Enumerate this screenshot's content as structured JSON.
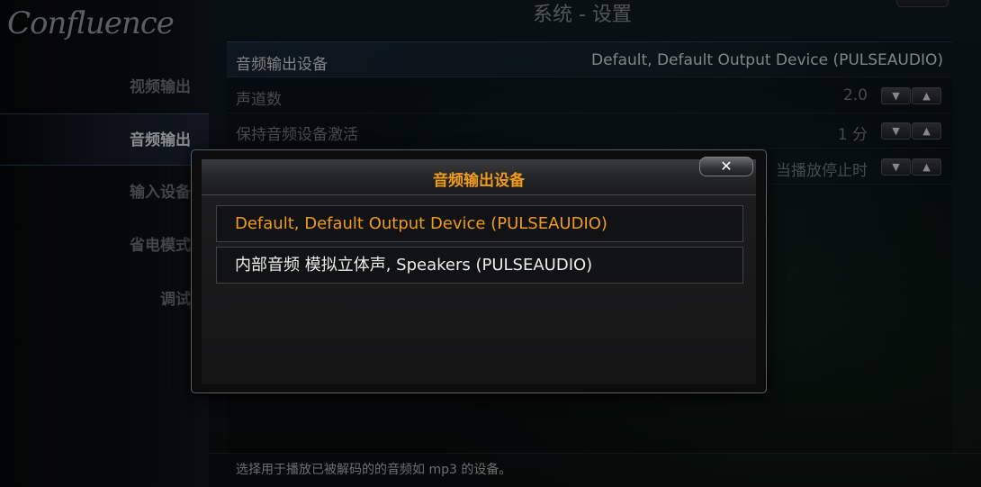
{
  "logo": "Confluence",
  "page_title": "系统 - 设置",
  "sidebar": {
    "items": [
      {
        "label": "视频输出",
        "active": false
      },
      {
        "label": "音频输出",
        "active": true
      },
      {
        "label": "输入设备",
        "active": false
      },
      {
        "label": "省电模式",
        "active": false
      },
      {
        "label": "调试",
        "active": false
      }
    ]
  },
  "settings": [
    {
      "label": "音频输出设备",
      "value": "Default, Default Output Device (PULSEAUDIO)"
    },
    {
      "label": "声道数",
      "value": "2.0"
    },
    {
      "label": "保持音频设备激活",
      "value": "1 分"
    },
    {
      "label": "",
      "value": "当播放停止时"
    }
  ],
  "spinner": {
    "down": "▼",
    "up": "▲"
  },
  "hint": "选择用于播放已被解码的的音频如 mp3 的设备。",
  "dialog": {
    "title": "音频输出设备",
    "close_label": "✕",
    "options": [
      {
        "label": "Default, Default Output Device (PULSEAUDIO)",
        "selected": true
      },
      {
        "label": "内部音频 模拟立体声, Speakers (PULSEAUDIO)",
        "selected": false
      }
    ]
  },
  "colors": {
    "accent": "#ef9b1c",
    "text": "#e8e8e8",
    "dim_text": "#6e7276"
  }
}
